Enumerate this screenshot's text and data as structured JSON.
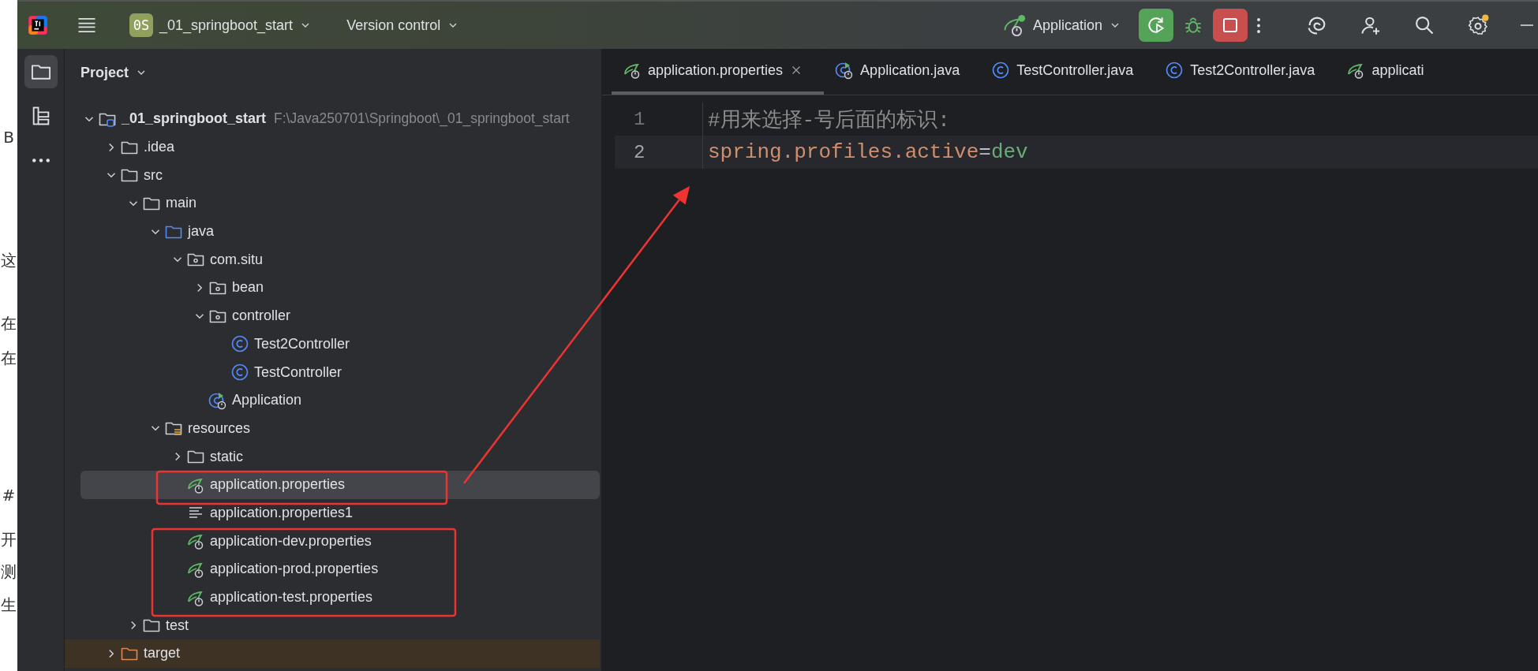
{
  "background_page": {
    "lines": [
      "B",
      "这",
      "在",
      "在",
      "#",
      "开",
      "测",
      "生"
    ]
  },
  "title_bar": {
    "project_badge": "0S",
    "project_name": "_01_springboot_start",
    "vcs_menu": "Version control",
    "run_configuration": "Application"
  },
  "tool_window_bar": {
    "items": [
      {
        "kind": "project",
        "selected": true
      },
      {
        "kind": "structure",
        "selected": false
      },
      {
        "kind": "more",
        "selected": false
      }
    ]
  },
  "project_panel": {
    "title": "Project",
    "tree": [
      {
        "name": "_01_springboot_start",
        "path": "F:\\Java250701\\Springboot\\_01_springboot_start",
        "kind": "module",
        "expanded": true,
        "selected": false,
        "children": [
          {
            "name": ".idea",
            "kind": "folder",
            "expanded": false,
            "selected": false
          },
          {
            "name": "src",
            "kind": "folder",
            "expanded": true,
            "selected": false,
            "children": [
              {
                "name": "main",
                "kind": "folder",
                "expanded": true,
                "selected": false,
                "children": [
                  {
                    "name": "java",
                    "kind": "source_folder",
                    "expanded": true,
                    "selected": false,
                    "children": [
                      {
                        "name": "com.situ",
                        "kind": "package",
                        "expanded": true,
                        "selected": false,
                        "children": [
                          {
                            "name": "bean",
                            "kind": "package",
                            "expanded": false,
                            "selected": false
                          },
                          {
                            "name": "controller",
                            "kind": "package",
                            "expanded": true,
                            "selected": false,
                            "children": [
                              {
                                "name": "Test2Controller",
                                "kind": "class",
                                "selected": false
                              },
                              {
                                "name": "TestController",
                                "kind": "class",
                                "selected": false
                              }
                            ]
                          },
                          {
                            "name": "Application",
                            "kind": "spring_app",
                            "selected": false
                          }
                        ]
                      }
                    ]
                  },
                  {
                    "name": "resources",
                    "kind": "resources_folder",
                    "expanded": true,
                    "selected": false,
                    "children": [
                      {
                        "name": "static",
                        "kind": "folder",
                        "expanded": false,
                        "selected": false
                      },
                      {
                        "name": "application.properties",
                        "kind": "spring_config",
                        "selected": true
                      },
                      {
                        "name": "application.properties1",
                        "kind": "text_file",
                        "selected": false
                      },
                      {
                        "name": "application-dev.properties",
                        "kind": "spring_config",
                        "selected": false
                      },
                      {
                        "name": "application-prod.properties",
                        "kind": "spring_config",
                        "selected": false
                      },
                      {
                        "name": "application-test.properties",
                        "kind": "spring_config",
                        "selected": false
                      }
                    ]
                  }
                ]
              },
              {
                "name": "test",
                "kind": "folder",
                "expanded": false,
                "selected": false
              }
            ]
          },
          {
            "name": "target",
            "kind": "excluded_folder",
            "expanded": false,
            "selected": false
          }
        ]
      }
    ]
  },
  "editor": {
    "tabs": [
      {
        "label": "application.properties",
        "kind": "spring_config",
        "selected": true
      },
      {
        "label": "Application.java",
        "kind": "spring_app",
        "selected": false
      },
      {
        "label": "TestController.java",
        "kind": "class",
        "selected": false
      },
      {
        "label": "Test2Controller.java",
        "kind": "class",
        "selected": false
      },
      {
        "label": "applicati",
        "kind": "spring_config",
        "selected": false
      }
    ],
    "lines": [
      {
        "number": "1",
        "current": false,
        "tokens": [
          {
            "kind": "comment",
            "text": "#用来选择-号后面的标识:"
          }
        ]
      },
      {
        "number": "2",
        "current": true,
        "tokens": [
          {
            "kind": "key",
            "text": "spring.profiles.active"
          },
          {
            "kind": "operator",
            "text": "="
          },
          {
            "kind": "value",
            "text": "dev"
          }
        ]
      }
    ]
  },
  "annotations": [
    {
      "kind": "box"
    },
    {
      "kind": "box"
    },
    {
      "kind": "arrow"
    }
  ]
}
